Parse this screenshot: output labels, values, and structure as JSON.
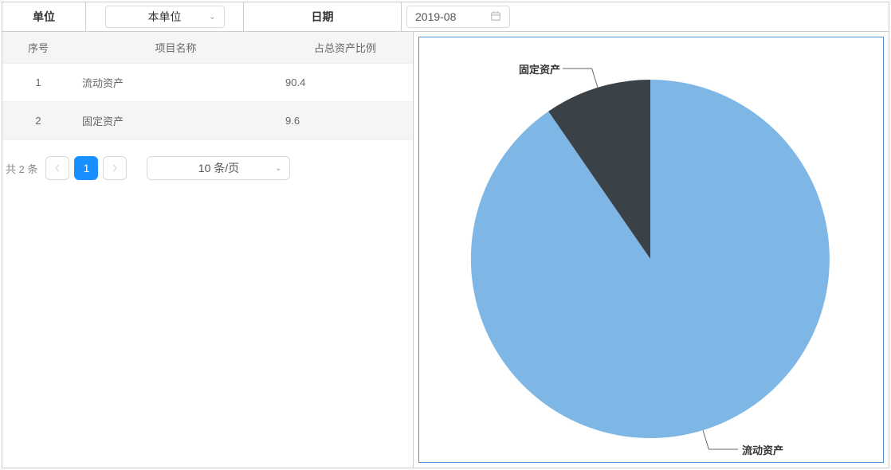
{
  "filters": {
    "unit_label": "单位",
    "unit_select": "本单位",
    "date_label": "日期",
    "date_value": "2019-08"
  },
  "table": {
    "columns": [
      "序号",
      "项目名称",
      "占总资产比例"
    ],
    "rows": [
      {
        "idx": "1",
        "name": "流动资产",
        "ratio": "90.4"
      },
      {
        "idx": "2",
        "name": "固定资产",
        "ratio": "9.6"
      }
    ]
  },
  "pagination": {
    "total_text": "共 2 条",
    "current_page": "1",
    "page_size_label": "10 条/页"
  },
  "chart_data": {
    "type": "pie",
    "series": [
      {
        "name": "流动资产",
        "value": 90.4,
        "color": "#7eb6e6"
      },
      {
        "name": "固定资产",
        "value": 9.6,
        "color": "#3a4147"
      }
    ]
  },
  "chart_labels": {
    "fixed": "固定资产",
    "liquid": "流动资产"
  }
}
